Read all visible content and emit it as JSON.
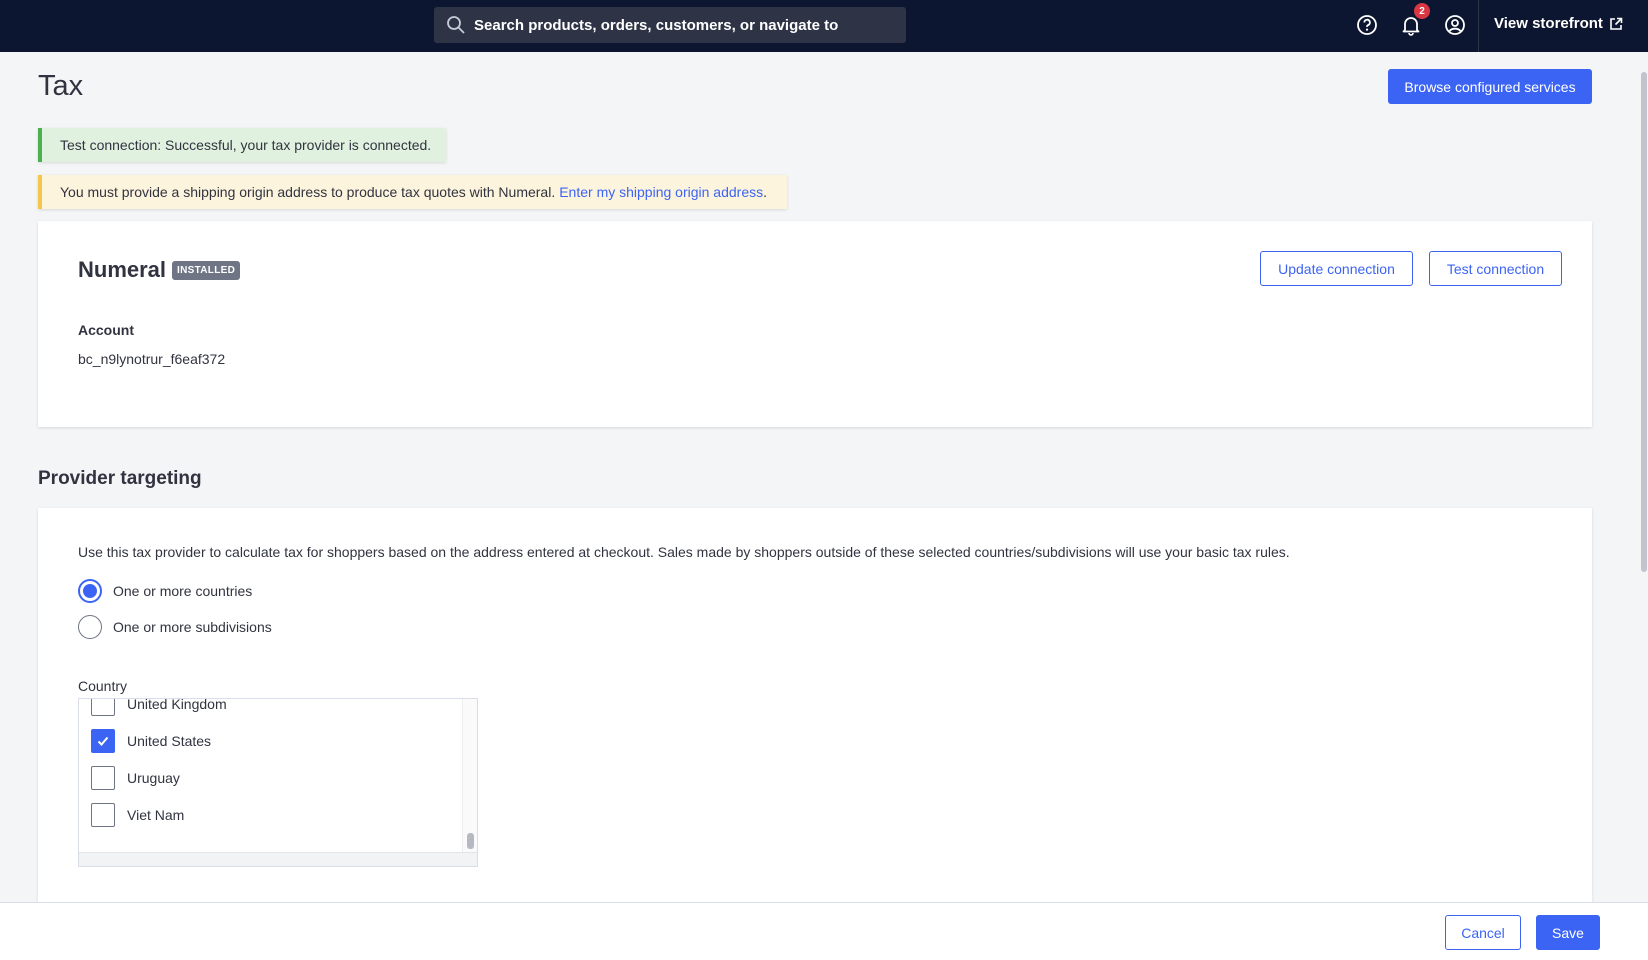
{
  "topbar": {
    "search_placeholder": "Search products, orders, customers, or navigate to",
    "notifications_count": "2",
    "view_storefront_label": "View storefront",
    "background_color": "#0d1630"
  },
  "page": {
    "title": "Tax",
    "browse_button": "Browse configured services"
  },
  "alerts": {
    "success_text": "Test connection: Successful, your tax provider is connected.",
    "warning_text": "You must provide a shipping origin address to produce tax quotes with Numeral.",
    "warning_link": "Enter my shipping origin address",
    "warning_suffix": "."
  },
  "provider": {
    "name": "Numeral",
    "status_badge": "INSTALLED",
    "update_button": "Update connection",
    "test_button": "Test connection",
    "account_label": "Account",
    "account_value": "bc_n9lynotrur_f6eaf372"
  },
  "targeting": {
    "section_title": "Provider targeting",
    "description": "Use this tax provider to calculate tax for shoppers based on the address entered at checkout. Sales made by shoppers outside of these selected countries/subdivisions will use your basic tax rules.",
    "options": [
      {
        "label": "One or more countries",
        "selected": true
      },
      {
        "label": "One or more subdivisions",
        "selected": false
      }
    ],
    "country_label": "Country",
    "countries": [
      {
        "label": "United Kingdom",
        "checked": false
      },
      {
        "label": "United States",
        "checked": true
      },
      {
        "label": "Uruguay",
        "checked": false
      },
      {
        "label": "Viet Nam",
        "checked": false
      }
    ]
  },
  "footer": {
    "cancel_label": "Cancel",
    "save_label": "Save"
  },
  "colors": {
    "accent": "#3c64f4",
    "success": "#4caf50",
    "warning": "#f3c74b",
    "badge_red": "#db3643"
  }
}
